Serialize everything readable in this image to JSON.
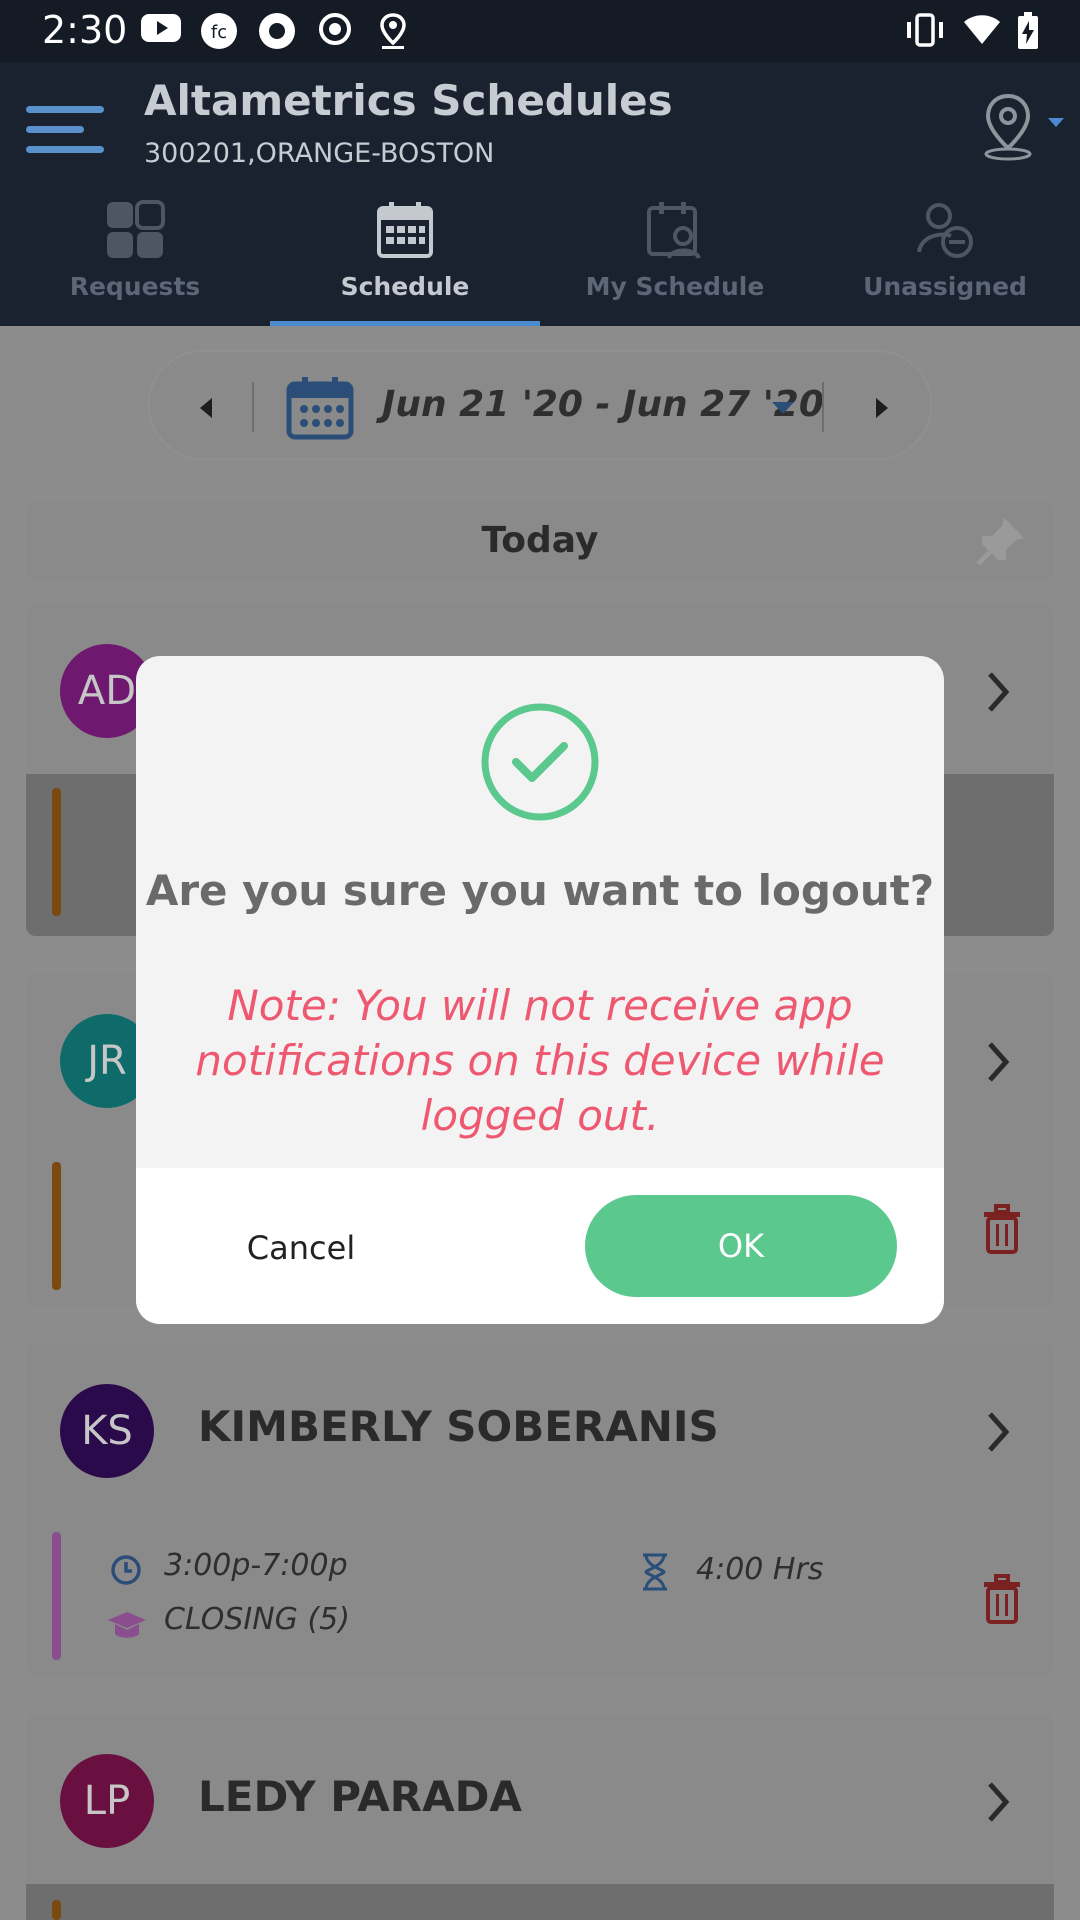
{
  "status_bar": {
    "time": "2:30"
  },
  "header": {
    "title": "Altametrics Schedules",
    "subtitle": "300201,ORANGE-BOSTON"
  },
  "tabs": [
    {
      "label": "Requests",
      "icon": "grid-icon",
      "active": false
    },
    {
      "label": "Schedule",
      "icon": "calendar-icon",
      "active": true
    },
    {
      "label": "My Schedule",
      "icon": "calendar-user-icon",
      "active": false
    },
    {
      "label": "Unassigned",
      "icon": "user-minus-icon",
      "active": false
    }
  ],
  "date_nav": {
    "range": "Jun 21 '20 - Jun 27 '20"
  },
  "today": {
    "label": "Today"
  },
  "employees": [
    {
      "initials": "AD",
      "avatar_color": "#6e1870",
      "bar_color": "#7a4a10"
    },
    {
      "initials": "JR",
      "avatar_color": "#0f6a6a",
      "bar_color": "#7a4a10"
    },
    {
      "initials": "KS",
      "name": "KIMBERLY SOBERANIS",
      "avatar_color": "#2a0a4a",
      "bar_color": "#8a4e8e",
      "time": "3:00p-7:00p",
      "role": "CLOSING (5)",
      "hours": "4:00 Hrs"
    },
    {
      "initials": "LP",
      "name": "LEDY PARADA",
      "avatar_color": "#6a1040",
      "bar_color": "#7a4a10"
    }
  ],
  "dialog": {
    "question": "Are you sure you want to logout?",
    "note": "Note: You will not receive app notifications on this device while logged out.",
    "cancel_label": "Cancel",
    "ok_label": "OK",
    "accent_color": "#5bc88e",
    "note_color": "#ee5870"
  }
}
